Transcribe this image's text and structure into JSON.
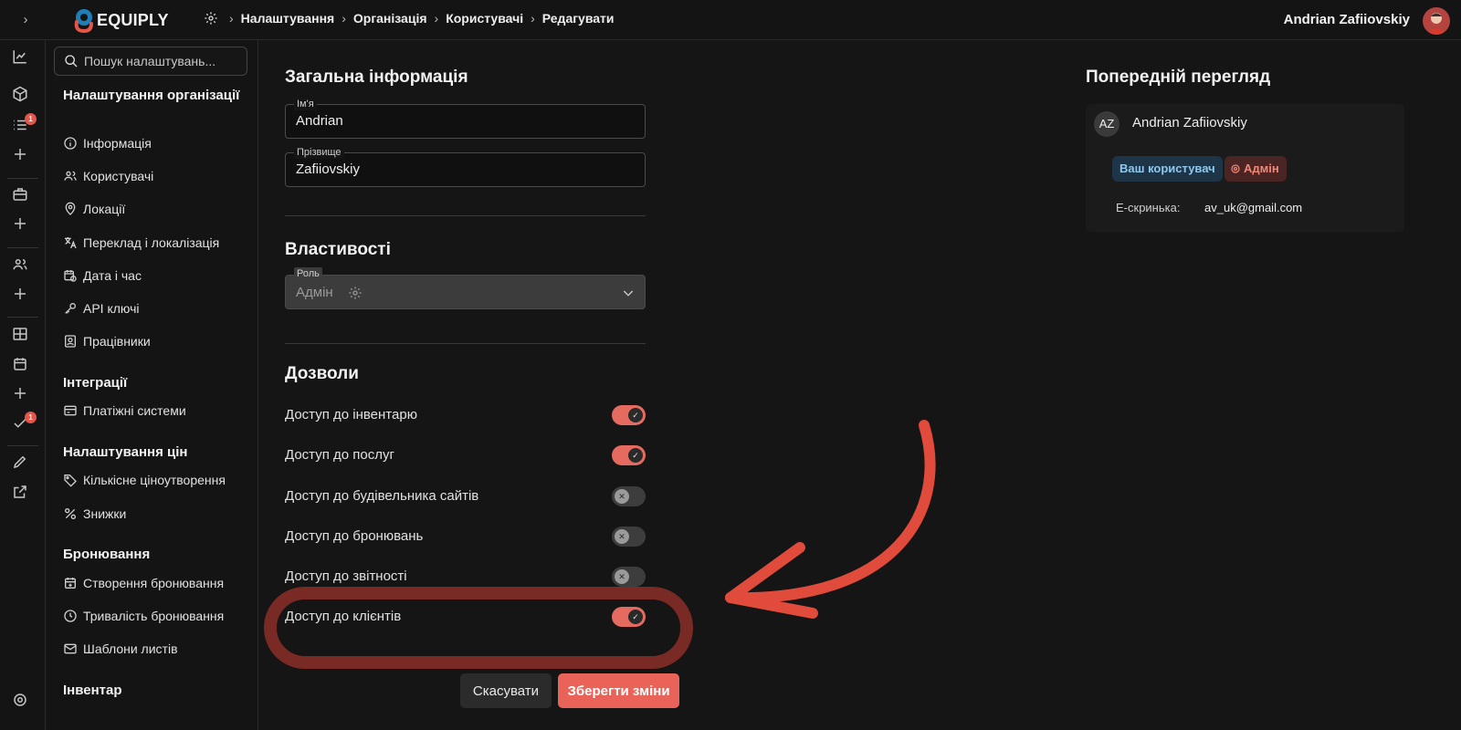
{
  "topbar": {
    "brand": "EQUIPLY",
    "breadcrumbs": [
      "Налаштування",
      "Організація",
      "Користувачі",
      "Редагувати"
    ],
    "user_name": "Andrian Zafiiovskiy"
  },
  "rail": {
    "icons": [
      "chart-icon",
      "box-icon",
      "list-icon",
      "plus-icon",
      "briefcase-icon",
      "plus-icon",
      "users-icon",
      "plus-icon",
      "grid-icon",
      "calendar-icon",
      "plus-icon",
      "check-icon",
      "pencil-icon",
      "external-link-icon",
      "gear-icon"
    ],
    "badges": [
      "1",
      "1"
    ]
  },
  "sidebar": {
    "search_placeholder": "Пошук налаштувань...",
    "groups": [
      {
        "title": "Налаштування організації",
        "items": [
          "Інформація",
          "Користувачі",
          "Локації",
          "Переклад і локалізація",
          "Дата і час",
          "API ключі",
          "Працівники"
        ]
      },
      {
        "title": "Інтеграції",
        "items": [
          "Платіжні системи"
        ]
      },
      {
        "title": "Налаштування цін",
        "items": [
          "Кількісне ціноутворення",
          "Знижки"
        ]
      },
      {
        "title": "Бронювання",
        "items": [
          "Створення бронювання",
          "Тривалість бронювання",
          "Шаблони листів"
        ]
      },
      {
        "title": "Інвентар",
        "items": []
      }
    ]
  },
  "general": {
    "title": "Загальна інформація",
    "first_name_label": "Ім'я",
    "first_name_value": "Andrian",
    "last_name_label": "Прізвище",
    "last_name_value": "Zafiiovskiy"
  },
  "properties": {
    "title": "Властивості",
    "role_label": "Роль",
    "role_value": "Адмін"
  },
  "permissions": {
    "title": "Дозволи",
    "items": [
      {
        "label": "Доступ до інвентарю",
        "enabled": true
      },
      {
        "label": "Доступ до послуг",
        "enabled": true
      },
      {
        "label": "Доступ до будівельника сайтів",
        "enabled": false
      },
      {
        "label": "Доступ до бронювань",
        "enabled": false
      },
      {
        "label": "Доступ до звітності",
        "enabled": false
      },
      {
        "label": "Доступ до клієнтів",
        "enabled": true
      }
    ]
  },
  "actions": {
    "cancel": "Скасувати",
    "save": "Зберегти зміни"
  },
  "preview": {
    "title": "Попередній перегляд",
    "initials": "AZ",
    "name": "Andrian Zafiiovskiy",
    "tag_own": "Ваш користувач",
    "tag_role": "Адмін",
    "email_label": "Е-скринька:",
    "email": "av_uk@gmail.com"
  },
  "colors": {
    "accent": "#e96358",
    "annotation": "#e14b3c",
    "background": "#151515"
  }
}
